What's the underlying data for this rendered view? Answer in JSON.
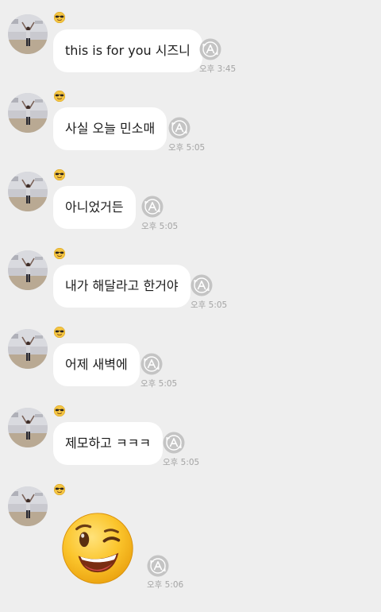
{
  "messages": [
    {
      "text": "this is for you 시즈니",
      "time": "오후 3:45"
    },
    {
      "text": "사실 오늘 민소매",
      "time": "오후 5:05"
    },
    {
      "text": "아니었거든",
      "time": "오후 5:05"
    },
    {
      "text": "내가 해달라고 한거야",
      "time": "오후 5:05"
    },
    {
      "text": "어제 새벽에",
      "time": "오후 5:05"
    },
    {
      "text": "제모하고 ㅋㅋㅋ",
      "time": "오후 5:05"
    }
  ],
  "sticker": {
    "time": "오후 5:06",
    "icon": "winking-face-icon"
  },
  "colors": {
    "background": "#eeeeee",
    "bubble": "#ffffff",
    "time": "#a4a4a4",
    "status_icon": "#c4c4c4"
  }
}
